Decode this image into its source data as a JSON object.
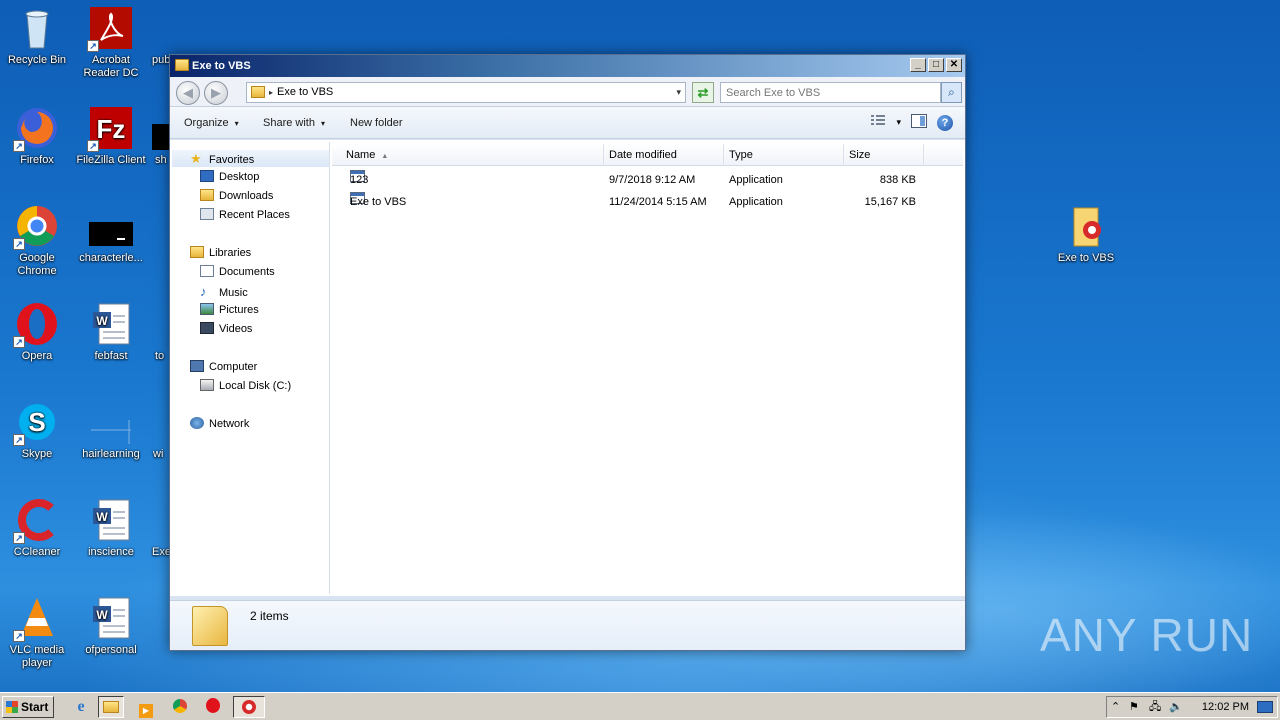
{
  "desktop": {
    "icons": [
      {
        "label": "Recycle Bin"
      },
      {
        "label": "Acrobat Reader DC"
      },
      {
        "label": "pub"
      },
      {
        "label": "Firefox"
      },
      {
        "label": "FileZilla Client"
      },
      {
        "label": "sh"
      },
      {
        "label": "Google Chrome"
      },
      {
        "label": "characterle..."
      },
      {
        "label": "Opera"
      },
      {
        "label": "febfast"
      },
      {
        "label": "to"
      },
      {
        "label": "Skype"
      },
      {
        "label": "hairlearning"
      },
      {
        "label": "wi"
      },
      {
        "label": "CCleaner"
      },
      {
        "label": "inscience"
      },
      {
        "label": "Exe"
      },
      {
        "label": "VLC media player"
      },
      {
        "label": "ofpersonal"
      },
      {
        "label": "Exe to VBS"
      }
    ],
    "watermark": "ANY RUN"
  },
  "window": {
    "title": "Exe to VBS",
    "minimize_label": "_",
    "maximize_label": "□",
    "close_label": "✕",
    "address": {
      "path": "Exe to VBS",
      "separator": "▸",
      "dropdown": "▾"
    },
    "search": {
      "placeholder": "Search Exe to VBS"
    },
    "toolbar": {
      "organize": "Organize",
      "share_with": "Share with",
      "new_folder": "New folder",
      "caret": "▾"
    },
    "nav": {
      "favorites": "Favorites",
      "desktop": "Desktop",
      "downloads": "Downloads",
      "recent_places": "Recent Places",
      "libraries": "Libraries",
      "documents": "Documents",
      "music": "Music",
      "pictures": "Pictures",
      "videos": "Videos",
      "computer": "Computer",
      "local_disk": "Local Disk (C:)",
      "network": "Network"
    },
    "columns": {
      "name": "Name",
      "date_modified": "Date modified",
      "type": "Type",
      "size": "Size",
      "sort_indicator": "▲"
    },
    "files": [
      {
        "name": "123",
        "date_modified": "9/7/2018 9:12 AM",
        "type": "Application",
        "size": "838 KB"
      },
      {
        "name": "Exe to VBS",
        "date_modified": "11/24/2014 5:15 AM",
        "type": "Application",
        "size": "15,167 KB"
      }
    ],
    "details": {
      "count": "2 items"
    }
  },
  "taskbar": {
    "start_label": "Start",
    "clock": "12:02 PM"
  },
  "colors": {
    "desktop_blue": "#1a6fc4",
    "titlebar_start": "#0a246a",
    "titlebar_end": "#a6caf0"
  }
}
